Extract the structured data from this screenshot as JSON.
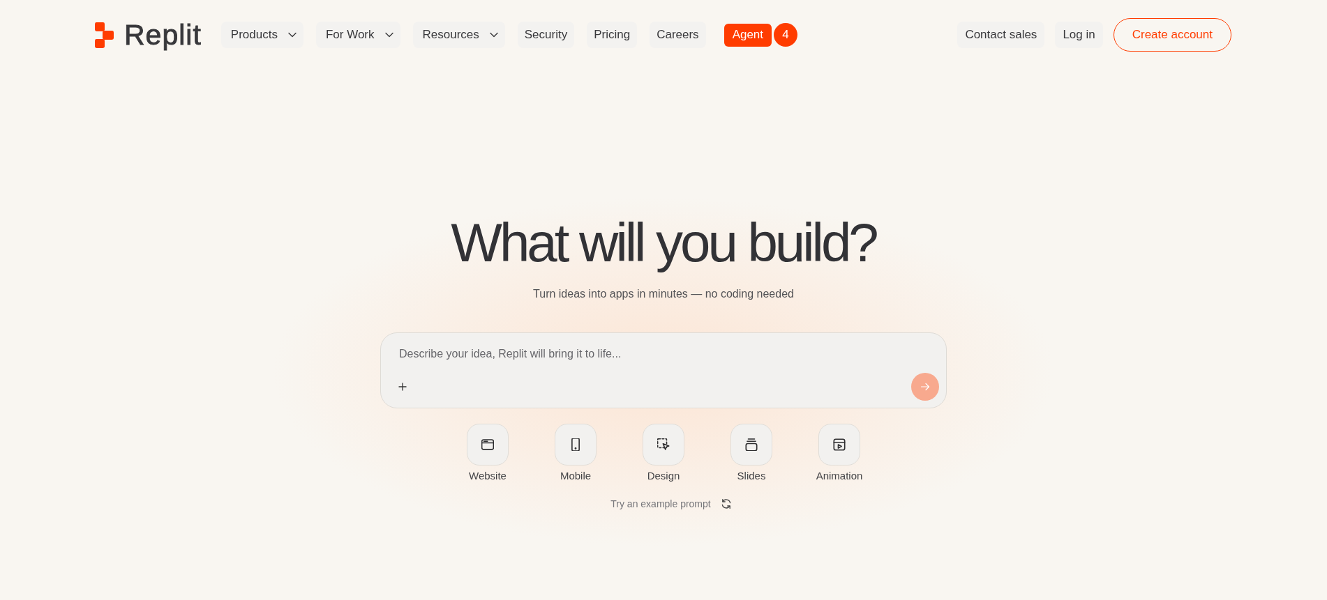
{
  "header": {
    "logo_text": "Replit",
    "nav": [
      {
        "label": "Products",
        "kind": "dropdown"
      },
      {
        "label": "For Work",
        "kind": "dropdown"
      },
      {
        "label": "Resources",
        "kind": "dropdown"
      },
      {
        "label": "Security",
        "kind": "link"
      },
      {
        "label": "Pricing",
        "kind": "link"
      },
      {
        "label": "Careers",
        "kind": "link"
      },
      {
        "label": "Agent",
        "kind": "highlight",
        "badge": "4"
      }
    ],
    "actions": [
      {
        "label": "Contact sales",
        "kind": "pill"
      },
      {
        "label": "Log in",
        "kind": "pill"
      },
      {
        "label": "Create account",
        "kind": "outline"
      }
    ]
  },
  "hero": {
    "title": "What will you build?",
    "subtitle": "Turn ideas into apps in minutes — no coding needed"
  },
  "prompt": {
    "placeholder": "Describe your idea, Replit will bring it to life...",
    "send_button": {
      "disabled": true
    }
  },
  "modes": [
    {
      "label": "Website",
      "kind": "browser"
    },
    {
      "label": "Mobile",
      "kind": "phone"
    },
    {
      "label": "Design",
      "kind": "selection"
    },
    {
      "label": "Slides",
      "kind": "stack"
    },
    {
      "label": "Animation",
      "kind": "player"
    }
  ],
  "example_prompt": {
    "label": "Try an example prompt"
  }
}
